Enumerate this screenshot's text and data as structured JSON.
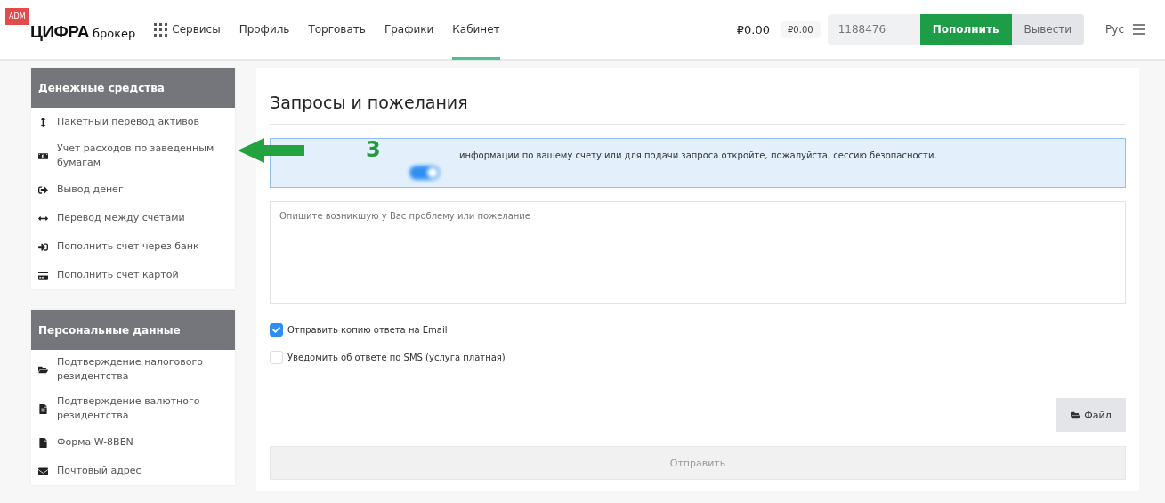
{
  "header": {
    "badge": "ADM",
    "logo": {
      "main": "ЦИФРА",
      "sub": "брокер"
    },
    "nav": [
      {
        "label": "Сервисы",
        "selected": false,
        "kind": "grid"
      },
      {
        "label": "Профиль",
        "selected": false,
        "kind": "plain"
      },
      {
        "label": "Торговать",
        "selected": false,
        "kind": "plain"
      },
      {
        "label": "Графики",
        "selected": false,
        "kind": "plain"
      },
      {
        "label": "Кабинет",
        "selected": true,
        "kind": "plain"
      }
    ],
    "balance": "₽0.00",
    "balance_small": "₽0.00",
    "account": "1188476",
    "deposit_button": "Пополнить",
    "withdraw_button": "Вывести",
    "language": "Рус"
  },
  "sidebar": [
    {
      "title": "Денежные средства",
      "items": [
        {
          "label": "Пакетный перевод активов"
        },
        {
          "label": "Учет расходов по заведенным бумагам"
        },
        {
          "label": "Вывод денег"
        },
        {
          "label": "Перевод между счетами"
        },
        {
          "label": "Пополнить счет через банк"
        },
        {
          "label": "Пополнить счет картой"
        }
      ]
    },
    {
      "title": "Персональные данные",
      "items": [
        {
          "label": "Подтверждение налогового резидентства"
        },
        {
          "label": "Подтверждение валютного резидентства"
        },
        {
          "label": "Форма W-8BEN"
        },
        {
          "label": "Почтовый адрес"
        }
      ]
    }
  ],
  "main": {
    "title": "Запросы и пожелания",
    "alert": {
      "text": "информации по вашему счету или для подачи запроса откройте, пожалуйста, сессию безопасности.",
      "security_toggle": {
        "on": true
      }
    },
    "textarea": {
      "placeholder": "Опишите возникшую у Вас проблему или пожелание"
    },
    "options": [
      {
        "label": "Отправить копию ответа на Email",
        "checked": true
      },
      {
        "label": "Уведомить об ответе по SMS (услуга платная)",
        "checked": false
      }
    ],
    "file_button": "Файл",
    "submit_button": "Отправить"
  },
  "annotation": {
    "label": "3"
  }
}
